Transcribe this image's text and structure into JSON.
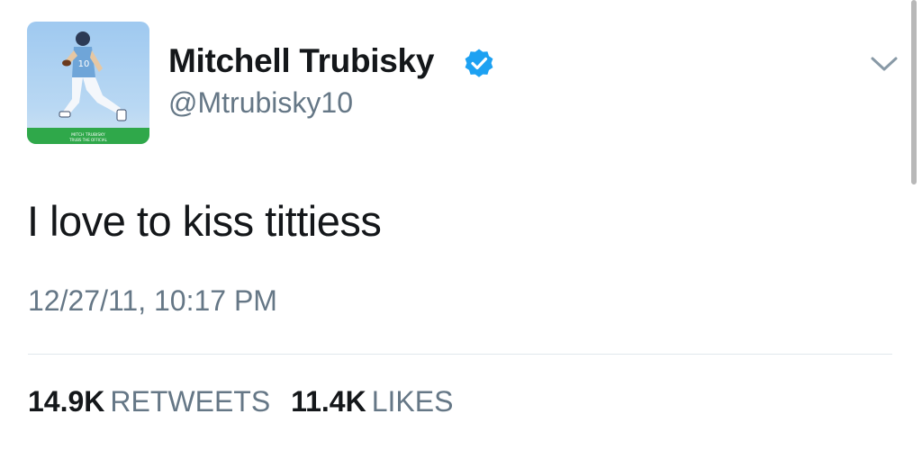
{
  "user": {
    "display_name": "Mitchell Trubisky",
    "handle": "@Mtrubisky10",
    "verified": true,
    "avatar_caption_line1": "MITCH TRUBISKY",
    "avatar_caption_line2": "TRUBS THE OFFICIAL"
  },
  "tweet": {
    "text": "I love to kiss tittiess",
    "timestamp": "12/27/11, 10:17 PM"
  },
  "stats": {
    "retweets_count": "14.9K",
    "retweets_label": "RETWEETS",
    "likes_count": "11.4K",
    "likes_label": "LIKES"
  },
  "icons": {
    "verified": "verified-badge-icon",
    "menu": "chevron-down-icon"
  },
  "colors": {
    "text_primary": "#14171a",
    "text_secondary": "#657786",
    "verified_blue": "#1da1f2",
    "divider": "#e1e8ed"
  }
}
